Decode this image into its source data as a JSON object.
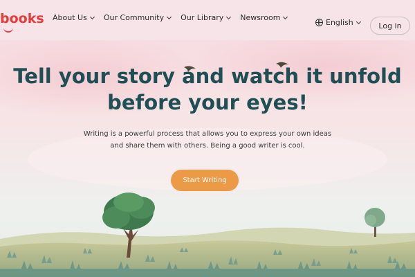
{
  "header": {
    "logo_text": "books",
    "nav": [
      {
        "label": "About Us"
      },
      {
        "label": "Our Community"
      },
      {
        "label": "Our Library"
      },
      {
        "label": "Newsroom"
      }
    ],
    "language": "English",
    "login_label": "Log in"
  },
  "hero": {
    "title": "Tell your story and watch it unfold before your eyes!",
    "subtitle": "Writing is a powerful process that allows you to express your own ideas and share them with others. Being a good writer is cool.",
    "cta_label": "Start Writing"
  },
  "colors": {
    "brand": "#e63b3b",
    "title": "#1f4f54",
    "cta": "#ec9a45",
    "header_bg": "#f7e4e8"
  },
  "icons": [
    "globe-icon",
    "chevron-down-icon",
    "bird-icon",
    "tree-icon"
  ]
}
